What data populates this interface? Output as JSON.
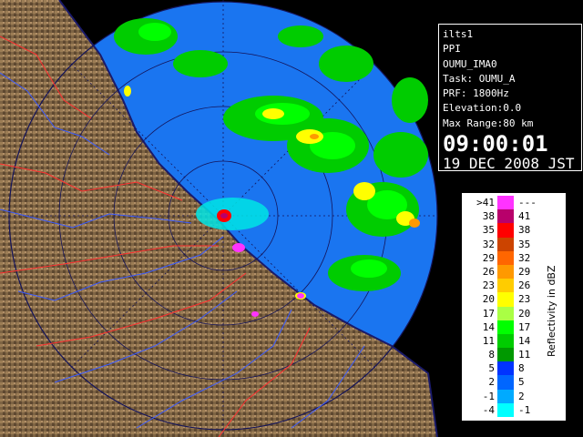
{
  "info": {
    "radar_id": "ilts1",
    "scan_type": "PPI",
    "product": "OUMU_IMA0",
    "task": "Task: OUMU_A",
    "prf": "PRF: 1800Hz",
    "elevation": "Elevation:0.0",
    "max_range": "Max Range:80 km",
    "time": "09:00:01",
    "date": "19 DEC 2008 JST"
  },
  "legend": {
    "unit_label": "Reflectivity in dBZ",
    "rows": [
      {
        "low": ">41",
        "high": "---",
        "color": "#ff33ff"
      },
      {
        "low": "38",
        "high": "41",
        "color": "#b8006b"
      },
      {
        "low": "35",
        "high": "38",
        "color": "#ff0000"
      },
      {
        "low": "32",
        "high": "35",
        "color": "#cc4400"
      },
      {
        "low": "29",
        "high": "32",
        "color": "#ff6600"
      },
      {
        "low": "26",
        "high": "29",
        "color": "#ff9900"
      },
      {
        "low": "23",
        "high": "26",
        "color": "#ffcc00"
      },
      {
        "low": "20",
        "high": "23",
        "color": "#ffff00"
      },
      {
        "low": "17",
        "high": "20",
        "color": "#aaff44"
      },
      {
        "low": "14",
        "high": "17",
        "color": "#00ff00"
      },
      {
        "low": "11",
        "high": "14",
        "color": "#00cc00"
      },
      {
        "low": "8",
        "high": "11",
        "color": "#009900"
      },
      {
        "low": "5",
        "high": "8",
        "color": "#0033ff"
      },
      {
        "low": "2",
        "high": "5",
        "color": "#0066ff"
      },
      {
        "low": "-1",
        "high": "2",
        "color": "#00aaff"
      },
      {
        "low": "-4",
        "high": "-1",
        "color": "#00ffff"
      }
    ]
  },
  "colors": {
    "sea_scan": "#1a75f0",
    "land": "#7a6040",
    "rivers": "#3b5bff",
    "boundaries": "#ff3030",
    "coast": "#1a1a6a"
  }
}
